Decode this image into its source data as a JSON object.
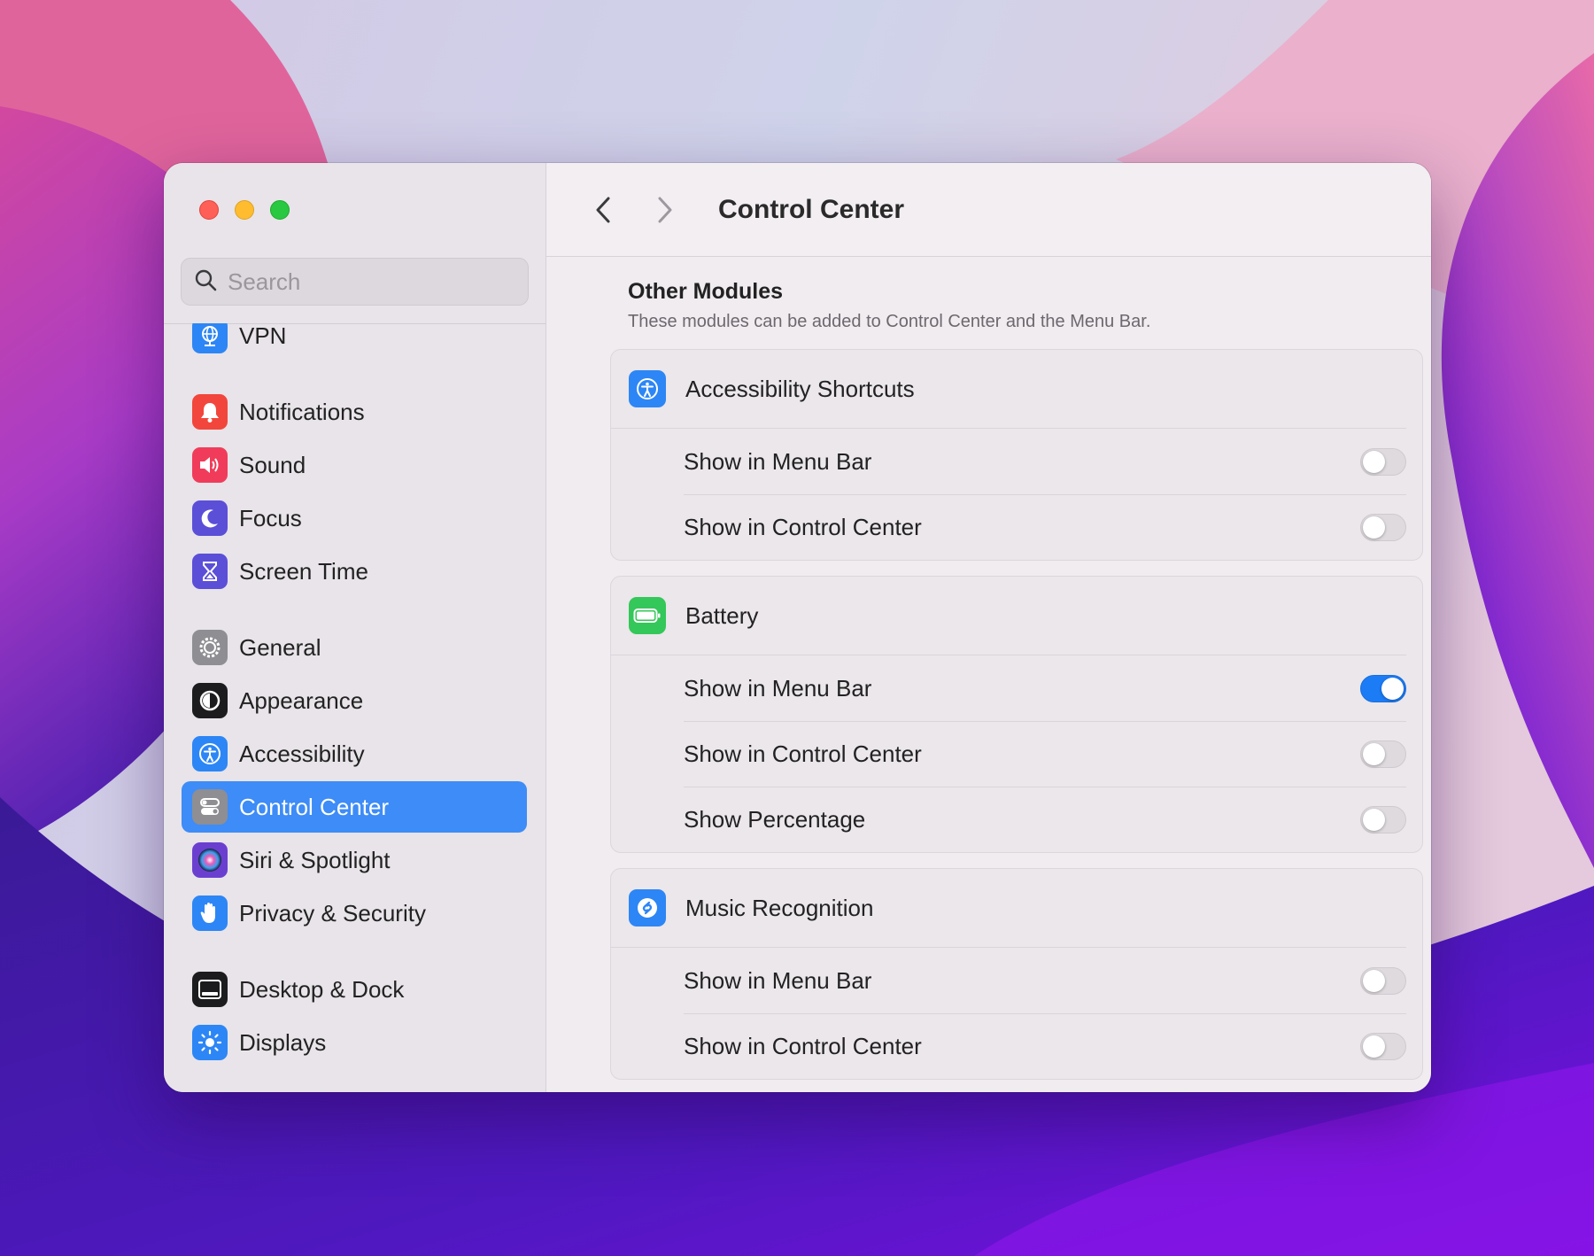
{
  "search": {
    "placeholder": "Search"
  },
  "sidebar": {
    "items": [
      {
        "label": "VPN",
        "icon": "globe-icon",
        "color": "#2d86f5"
      },
      {
        "label": "Notifications",
        "icon": "bell-icon",
        "color": "#f2463c"
      },
      {
        "label": "Sound",
        "icon": "speaker-icon",
        "color": "#f03c5a"
      },
      {
        "label": "Focus",
        "icon": "moon-icon",
        "color": "#5b4fd8"
      },
      {
        "label": "Screen Time",
        "icon": "hourglass-icon",
        "color": "#5b4fd8"
      },
      {
        "label": "General",
        "icon": "gear-icon",
        "color": "#8e8e93"
      },
      {
        "label": "Appearance",
        "icon": "appearance-icon",
        "color": "#1c1c1e"
      },
      {
        "label": "Accessibility",
        "icon": "accessibility-icon",
        "color": "#2d86f5"
      },
      {
        "label": "Control Center",
        "icon": "control-center-icon",
        "color": "#8e8e93",
        "selected": true
      },
      {
        "label": "Siri & Spotlight",
        "icon": "siri-icon",
        "color": "#6a3fd0"
      },
      {
        "label": "Privacy & Security",
        "icon": "hand-icon",
        "color": "#2d86f5"
      },
      {
        "label": "Desktop & Dock",
        "icon": "dock-icon",
        "color": "#1c1c1e"
      },
      {
        "label": "Displays",
        "icon": "sun-icon",
        "color": "#2d86f5"
      }
    ]
  },
  "toolbar": {
    "title": "Control Center"
  },
  "section": {
    "title": "Other Modules",
    "subtitle": "These modules can be added to Control Center and the Menu Bar."
  },
  "groups": [
    {
      "name": "Accessibility Shortcuts",
      "icon": "accessibility-icon",
      "color": "#2d86f5",
      "rows": [
        {
          "label": "Show in Menu Bar",
          "on": false
        },
        {
          "label": "Show in Control Center",
          "on": false
        }
      ]
    },
    {
      "name": "Battery",
      "icon": "battery-icon",
      "color": "#34c759",
      "rows": [
        {
          "label": "Show in Menu Bar",
          "on": true
        },
        {
          "label": "Show in Control Center",
          "on": false
        },
        {
          "label": "Show Percentage",
          "on": false
        }
      ]
    },
    {
      "name": "Music Recognition",
      "icon": "shazam-icon",
      "color": "#2d86f5",
      "rows": [
        {
          "label": "Show in Menu Bar",
          "on": false
        },
        {
          "label": "Show in Control Center",
          "on": false
        }
      ]
    }
  ]
}
